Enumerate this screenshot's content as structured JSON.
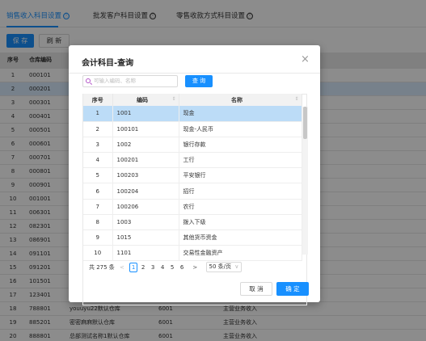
{
  "tabs": [
    {
      "label": "销售收入科目设置"
    },
    {
      "label": "批发客户科目设置"
    },
    {
      "label": "零售收款方式科目设置"
    }
  ],
  "tab_info_glyph": "ⓘ",
  "toolbar": {
    "save_label": "保 存",
    "refresh_label": "刷 新"
  },
  "bg_table": {
    "headers": [
      "序号",
      "仓库编码",
      "",
      "",
      ""
    ],
    "rows": [
      [
        "1",
        "000101",
        "",
        "",
        ""
      ],
      [
        "2",
        "000201",
        "",
        "",
        ""
      ],
      [
        "3",
        "000301",
        "",
        "",
        ""
      ],
      [
        "4",
        "000401",
        "",
        "",
        ""
      ],
      [
        "5",
        "000501",
        "",
        "",
        ""
      ],
      [
        "6",
        "000601",
        "",
        "",
        ""
      ],
      [
        "7",
        "000701",
        "",
        "",
        ""
      ],
      [
        "8",
        "000801",
        "",
        "",
        ""
      ],
      [
        "9",
        "000901",
        "",
        "",
        ""
      ],
      [
        "10",
        "001001",
        "",
        "",
        ""
      ],
      [
        "11",
        "006301",
        "",
        "",
        ""
      ],
      [
        "12",
        "082301",
        "",
        "",
        ""
      ],
      [
        "13",
        "086901",
        "",
        "",
        ""
      ],
      [
        "14",
        "091101",
        "",
        "",
        ""
      ],
      [
        "15",
        "091201",
        "",
        "",
        ""
      ],
      [
        "16",
        "101501",
        "",
        "",
        ""
      ],
      [
        "17",
        "123401",
        "",
        "",
        ""
      ],
      [
        "18",
        "788801",
        "youuyu22默认仓库",
        "6001",
        "主营业务收入"
      ],
      [
        "19",
        "885201",
        "密密麻麻默认仓库",
        "6001",
        "主营业务收入"
      ],
      [
        "20",
        "888801",
        "总部测试名称1默认仓库",
        "6001",
        "主营业务收入"
      ]
    ],
    "selected_row": 1
  },
  "modal": {
    "title": "会计科目-查询",
    "close_glyph": "×",
    "search_placeholder": "可输入编码、名称",
    "query_label": "查 询",
    "headers": [
      "序号",
      "编码",
      "名称"
    ],
    "sort_glyph": "⇕",
    "rows": [
      [
        "1",
        "1001",
        "现金"
      ],
      [
        "2",
        "100101",
        "现金-人民币"
      ],
      [
        "3",
        "1002",
        "银行存款"
      ],
      [
        "4",
        "100201",
        "工行"
      ],
      [
        "5",
        "100203",
        "平安银行"
      ],
      [
        "6",
        "100204",
        "招行"
      ],
      [
        "7",
        "100206",
        "农行"
      ],
      [
        "8",
        "1003",
        "拨入下级"
      ],
      [
        "9",
        "1015",
        "其他货币资金"
      ],
      [
        "10",
        "1101",
        "交易性金融资产"
      ]
    ],
    "selected_row": 0,
    "pagination": {
      "total_text": "共 275 条",
      "prev_glyph": "<",
      "next_glyph": ">",
      "pages": [
        "1",
        "2",
        "3",
        "4",
        "5",
        "6"
      ],
      "current_page": "1",
      "page_size": "50 条/页",
      "size_arrow": "∨"
    },
    "cancel_label": "取 消",
    "ok_label": "确 定"
  },
  "colors": {
    "primary": "#1890ff",
    "row_selected": "#bcdcf7"
  }
}
